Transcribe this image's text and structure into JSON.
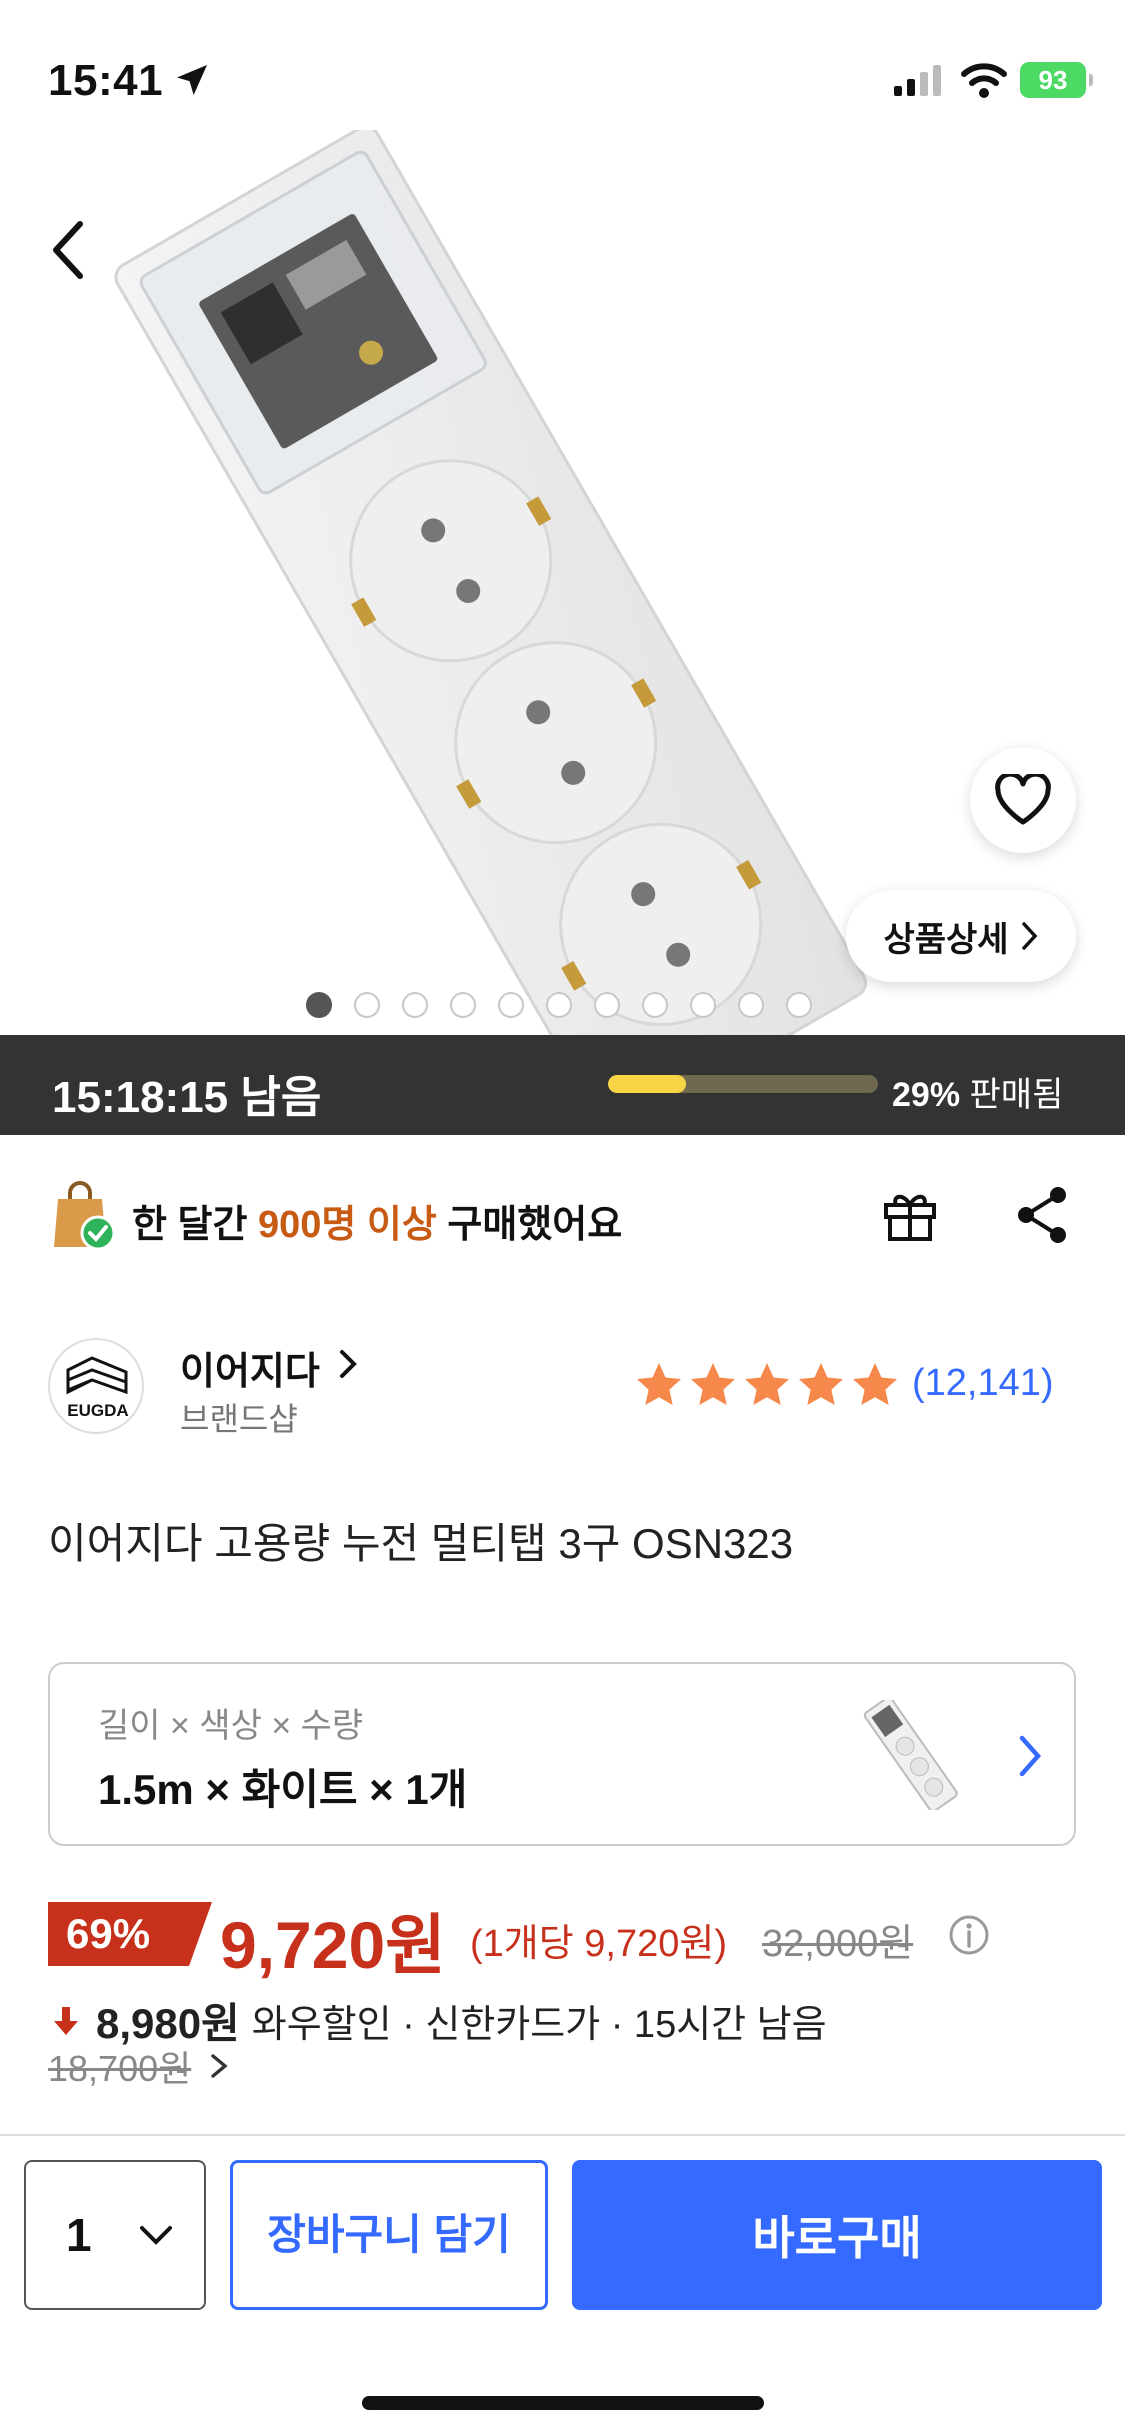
{
  "status_bar": {
    "time": "15:41",
    "battery": "93"
  },
  "hero": {
    "detail_button": "상품상세",
    "image_count": 11,
    "active_image_index": 0
  },
  "timer": {
    "remaining": "15:18:15 남음",
    "sold_percent": 29,
    "sold_percent_label": "29%",
    "sold_label": "판매됨"
  },
  "purchase_info": {
    "prefix": "한 달간",
    "highlight": "900명 이상",
    "suffix": "구매했어요"
  },
  "brand": {
    "name": "이어지다",
    "subtitle": "브랜드샵",
    "logo_text": "EUGDA",
    "rating": 5,
    "review_count": "(12,141)"
  },
  "product": {
    "title": "이어지다 고용량 누전 멀티탭 3구 OSN323"
  },
  "option": {
    "label": "길이 × 색상 × 수량",
    "value": "1.5m × 화이트 × 1개"
  },
  "price": {
    "discount": "69%",
    "sale_price": "9,720원",
    "unit_price": "(1개당 9,720원)",
    "original_price": "32,000원",
    "wow_price": "8,980원",
    "wow_text": "와우할인 · 신한카드가 · 15시간 남음",
    "old_price": "18,700원"
  },
  "bottom_bar": {
    "quantity": "1",
    "cart_label": "장바구니 담기",
    "buy_label": "바로구매"
  },
  "colors": {
    "accent": "#346aff",
    "price_red": "#c7301b",
    "highlight_orange": "#c75b14",
    "star": "#f5884a",
    "timer_bg": "#333333",
    "progress": "#f8d544"
  }
}
